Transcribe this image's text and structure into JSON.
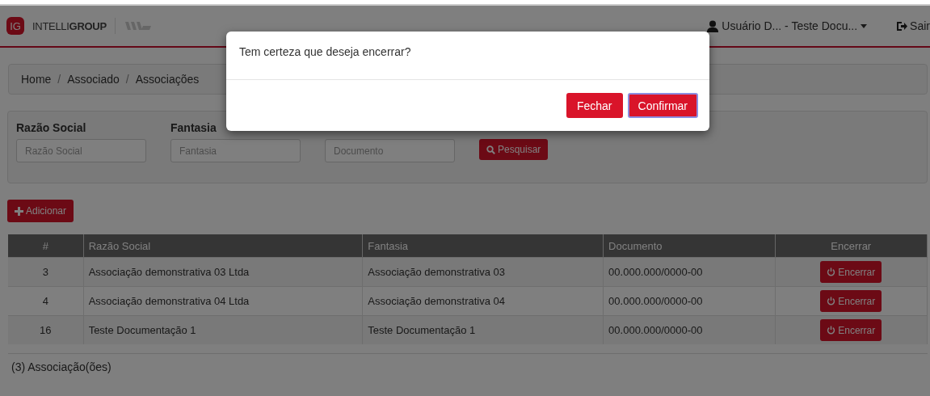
{
  "header": {
    "logo_badge": "IG",
    "logo_text": "INTELLI**GROUP**",
    "user_menu": "Usuário D... - Teste Docu...",
    "logout": "Sair"
  },
  "breadcrumb": [
    "Home",
    "Associado",
    "Associações"
  ],
  "breadcrumb_separator": "/",
  "filters": [
    {
      "label": "Razão Social",
      "placeholder": "Razão Social"
    },
    {
      "label": "Fantasia",
      "placeholder": "Fantasia"
    },
    {
      "placeholder": "Documento"
    }
  ],
  "search_button": "Pesquisar",
  "add_button": "Adicionar",
  "table": {
    "columns": [
      "#",
      "Razão Social",
      "Fantasia",
      "Documento",
      "Encerrar"
    ],
    "rows": [
      {
        "id": "3",
        "razao": "Associação demonstrativa 03 Ltda",
        "fantasia": "Associação demonstrativa 03",
        "documento": "00.000.000/0000-00",
        "action": "Encerrar"
      },
      {
        "id": "4",
        "razao": "Associação demonstrativa 04 Ltda",
        "fantasia": "Associação demonstrativa 04",
        "documento": "00.000.000/0000-00",
        "action": "Encerrar"
      },
      {
        "id": "16",
        "razao": "Teste Documentação 1",
        "fantasia": "Teste Documentação 1",
        "documento": "00.000.000/0000-00",
        "action": "Encerrar"
      }
    ]
  },
  "count": "(3) Associação(ões)",
  "modal": {
    "message": "Tem certeza que deseja encerrar?",
    "buttons": [
      {
        "label": "Fechar",
        "focused": false
      },
      {
        "label": "Confirmar",
        "focused": true
      }
    ]
  }
}
